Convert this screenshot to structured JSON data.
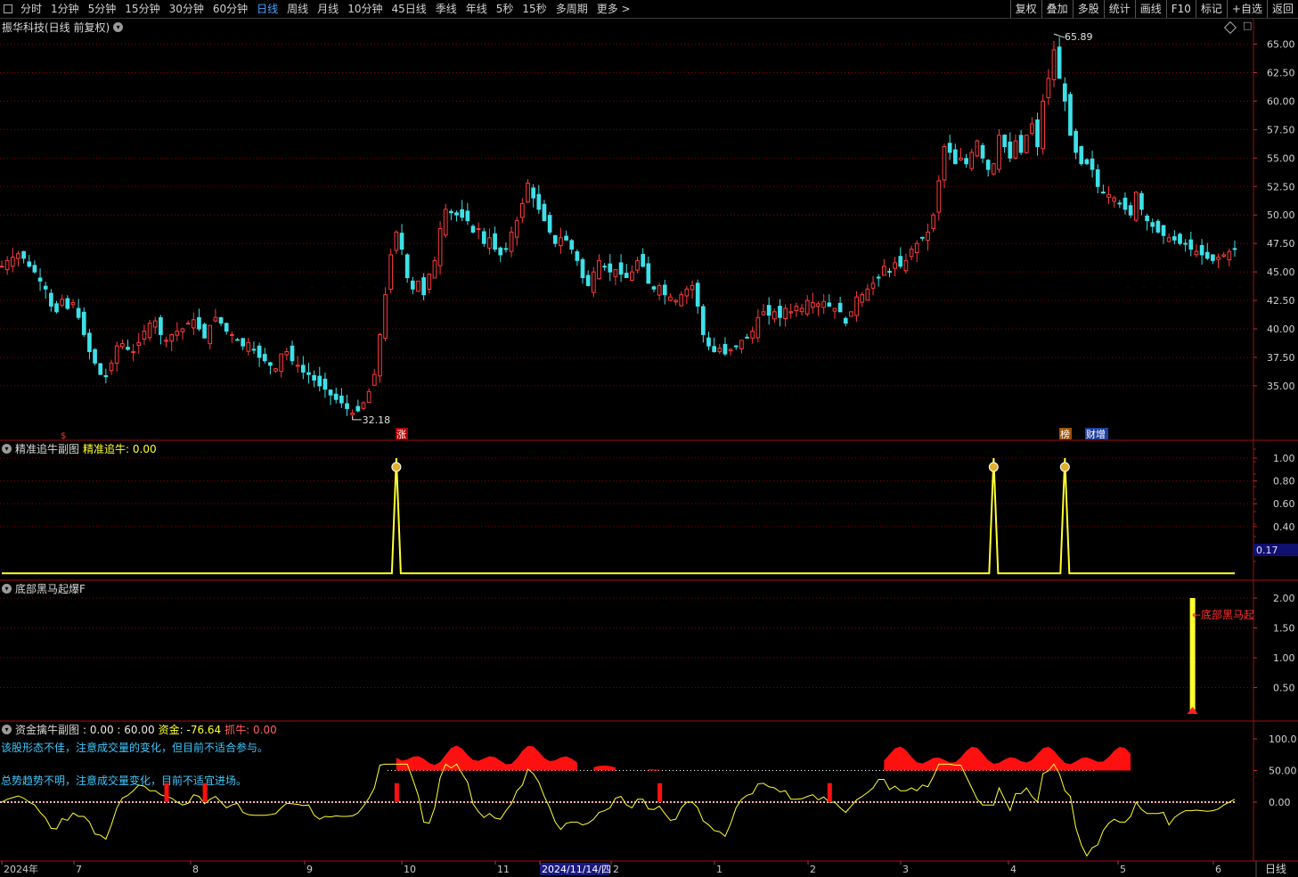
{
  "toolbar": {
    "periods": [
      "分时",
      "1分钟",
      "5分钟",
      "15分钟",
      "30分钟",
      "60分钟",
      "日线",
      "周线",
      "月线",
      "10分钟",
      "45日线",
      "季线",
      "年线",
      "5秒",
      "15秒",
      "多周期",
      "更多 >"
    ],
    "active_period": "日线",
    "right_buttons": [
      "复权",
      "叠加",
      "多股",
      "统计",
      "画线",
      "F10",
      "标记",
      "+自选",
      "返回"
    ]
  },
  "main_panel": {
    "title": "振华科技(日线 前复权)",
    "high_label": "65.89",
    "low_label": "32.18",
    "badges": [
      "涨",
      "榜",
      "财增"
    ],
    "price_ticks": [
      "65.00",
      "62.50",
      "60.00",
      "57.50",
      "55.00",
      "52.50",
      "50.00",
      "47.50",
      "45.00",
      "42.50",
      "40.00",
      "37.50",
      "35.00"
    ]
  },
  "panel2": {
    "name": "精准追牛副图",
    "value_label": "精准追牛: 0.00",
    "ticks": [
      "1.00",
      "0.80",
      "0.60",
      "0.40"
    ],
    "current_value": "0.17"
  },
  "panel3": {
    "name": "底部黑马起爆F",
    "ticks": [
      "2.00",
      "1.50",
      "1.00",
      "0.50"
    ],
    "annotation": "←底部黑马起"
  },
  "panel4": {
    "name": "资金擒牛副图",
    "values_text": ": 0.00 : 60.00",
    "fund_label": "资金: -76.64",
    "catch_label": "抓牛: 0.00",
    "ticks": [
      "100.0",
      "50.00",
      "0.00"
    ],
    "message1": "该股形态不佳，注意成交量的变化，但目前不适合参与。",
    "message2": "总势趋势不明，注意成交量变化，目前不适宜进场。"
  },
  "x_axis": {
    "labels": [
      "2024年",
      "7",
      "8",
      "9",
      "10",
      "11",
      "2024/11/14/四",
      "2",
      "1",
      "2",
      "3",
      "4",
      "5",
      "6"
    ],
    "period_label": "日线"
  },
  "colors": {
    "up": "#ff3b3b",
    "down": "#3ee0e8",
    "grid": "#8b0000",
    "panel_border": "#a01010",
    "yellow": "#ffff30",
    "cyan_text": "#3ec8ff"
  },
  "chart_data": {
    "type": "candlestick",
    "title": "振华科技(日线 前复权)",
    "ylim": [
      31.0,
      67.0
    ],
    "high": 65.89,
    "low": 32.18,
    "closes": [
      45.5,
      46.0,
      46.3,
      46.6,
      46.2,
      45.5,
      45.0,
      44.2,
      43.5,
      42.0,
      41.5,
      42.6,
      41.8,
      42.3,
      41.0,
      39.5,
      38.0,
      37.0,
      36.0,
      35.8,
      37.0,
      38.5,
      38.7,
      38.2,
      38.0,
      38.8,
      39.8,
      40.5,
      40.7,
      39.5,
      39.0,
      39.5,
      39.8,
      40.0,
      40.5,
      40.8,
      40.0,
      39.2,
      40.3,
      41.0,
      40.5,
      39.8,
      39.5,
      39.0,
      38.5,
      38.8,
      38.2,
      37.5,
      37.2,
      36.8,
      36.5,
      37.8,
      38.0,
      37.2,
      36.8,
      36.2,
      36.0,
      35.5,
      35.0,
      34.7,
      34.2,
      33.8,
      33.5,
      33.0,
      32.6,
      32.8,
      33.5,
      34.5,
      36.0,
      39.5,
      43.0,
      46.5,
      48.5,
      47.0,
      44.5,
      43.5,
      44.2,
      43.0,
      44.8,
      46.0,
      48.8,
      50.5,
      50.2,
      50.0,
      49.8,
      49.5,
      48.5,
      48.8,
      47.5,
      48.0,
      47.0,
      46.5,
      47.0,
      48.5,
      49.5,
      51.0,
      52.8,
      51.5,
      50.5,
      49.5,
      48.5,
      47.5,
      48.0,
      47.8,
      47.0,
      46.0,
      44.5,
      43.8,
      45.0,
      46.0,
      45.5,
      45.0,
      45.2,
      44.8,
      44.5,
      45.0,
      46.0,
      45.5,
      44.0,
      43.5,
      43.8,
      43.0,
      42.8,
      42.5,
      43.0,
      43.5,
      43.8,
      42.0,
      39.5,
      38.5,
      38.0,
      38.3,
      37.8,
      38.2,
      38.5,
      39.0,
      39.2,
      39.8,
      41.0,
      41.5,
      41.2,
      41.5,
      41.0,
      41.8,
      41.5,
      42.0,
      41.8,
      42.5,
      42.3,
      42.2,
      42.4,
      42.0,
      41.8,
      41.5,
      40.5,
      41.5,
      42.8,
      43.0,
      43.5,
      44.0,
      44.5,
      45.5,
      45.0,
      45.8,
      45.5,
      46.0,
      47.0,
      47.5,
      48.0,
      48.5,
      50.0,
      53.0,
      56.0,
      55.5,
      54.5,
      55.0,
      54.5,
      55.5,
      56.5,
      55.0,
      54.0,
      54.5,
      57.0,
      56.0,
      55.0,
      56.5,
      55.5,
      57.0,
      58.0,
      56.0,
      60.0,
      62.0,
      64.5,
      62.0,
      60.0,
      57.0,
      55.5,
      54.5,
      54.5,
      54.0,
      52.5,
      52.0,
      51.8,
      51.5,
      51.0,
      50.5,
      50.0,
      52.0,
      50.5,
      49.5,
      49.0,
      48.5,
      48.2,
      48.0,
      47.8,
      47.5,
      47.5,
      47.0,
      46.8,
      46.5,
      46.2,
      46.0,
      46.3,
      46.5,
      46.8,
      47.0
    ],
    "panel2_signals_x_index": [
      72,
      181,
      194
    ],
    "panel3_signal_x_index": [
      216
    ],
    "panel4_level_0": 0,
    "panel4_level_50": 50,
    "panel4_level_100": 100
  }
}
